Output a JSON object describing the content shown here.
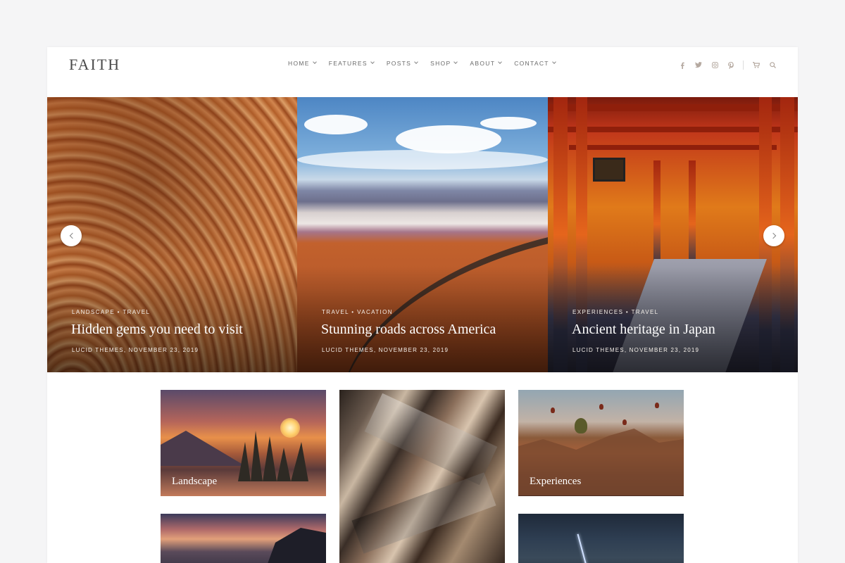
{
  "header": {
    "logo": "FAITH",
    "nav": [
      {
        "label": "HOME"
      },
      {
        "label": "FEATURES"
      },
      {
        "label": "POSTS"
      },
      {
        "label": "SHOP"
      },
      {
        "label": "ABOUT"
      },
      {
        "label": "CONTACT"
      }
    ],
    "social_icons": [
      "facebook-icon",
      "twitter-icon",
      "instagram-icon",
      "pinterest-icon"
    ],
    "utility_icons": [
      "cart-icon",
      "search-icon"
    ]
  },
  "slider": {
    "slides": [
      {
        "categories": "LANDSCAPE • TRAVEL",
        "title": "Hidden gems you need to visit",
        "meta": "LUCID THEMES, NOVEMBER 23, 2019"
      },
      {
        "categories": "TRAVEL • VACATION",
        "title": "Stunning roads across America",
        "meta": "LUCID THEMES, NOVEMBER 23, 2019"
      },
      {
        "categories": "EXPERIENCES • TRAVEL",
        "title": "Ancient heritage in Japan",
        "meta": "LUCID THEMES, NOVEMBER 23, 2019"
      }
    ]
  },
  "grid": {
    "tiles": [
      {
        "label": "Landscape"
      },
      {
        "label": ""
      },
      {
        "label": "Experiences"
      }
    ]
  },
  "colors": {
    "page_bg": "#f5f5f6",
    "site_bg": "#ffffff",
    "nav_text": "#6a6a6a",
    "social_icon": "#b5a9a0"
  }
}
